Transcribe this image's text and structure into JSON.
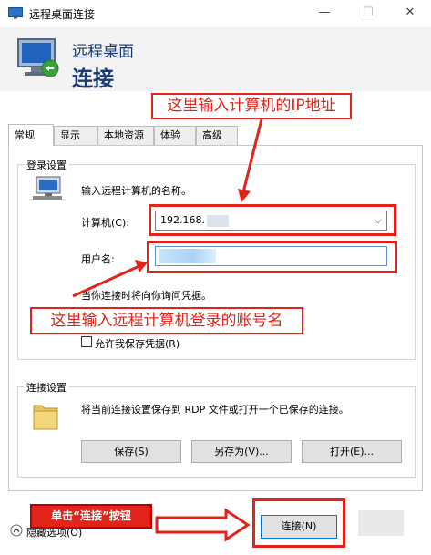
{
  "window": {
    "title": "远程桌面连接",
    "minimize": "—",
    "maximize": "☐",
    "close": "✕"
  },
  "header": {
    "line1": "远程桌面",
    "line2": "连接"
  },
  "tabs": [
    "常规",
    "显示",
    "本地资源",
    "体验",
    "高级"
  ],
  "login": {
    "group_title": "登录设置",
    "instruction": "输入远程计算机的名称。",
    "computer_label": "计算机(C):",
    "computer_value": "192.168.",
    "username_label": "用户名:",
    "prompt_text": "当你连接时将向你询问凭据。",
    "save_credentials_label": "允许我保存凭据(R)"
  },
  "connection": {
    "group_title": "连接设置",
    "description": "将当前连接设置保存到 RDP 文件或打开一个已保存的连接。",
    "save_label": "保存(S)",
    "save_as_label": "另存为(V)...",
    "open_label": "打开(E)..."
  },
  "footer": {
    "hide_options_label": "隐藏选项(O)",
    "connect_label": "连接(N)"
  },
  "annotations": {
    "ip_hint": "这里输入计算机的IP地址",
    "account_hint": "这里输入远程计算机登录的账号名",
    "click_hint": "单击“连接”按钮"
  },
  "colors": {
    "annotation": "#e2231a",
    "header_text": "#1b3a74"
  }
}
